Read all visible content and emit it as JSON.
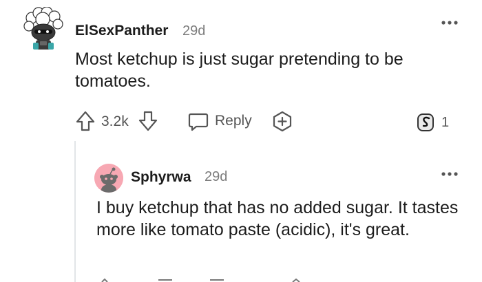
{
  "comment": {
    "author": "ElSexPanther",
    "time": "29d",
    "body": "Most ketchup is just sugar pretending to be tomatoes.",
    "votes": "3.2k",
    "reply_label": "Reply",
    "award_count": "1",
    "icons": {
      "avatar": "snoo-avatar-icon",
      "upvote": "arrow-up-icon",
      "downvote": "arrow-down-icon",
      "reply": "speech-bubble-icon",
      "award": "plus-award-icon",
      "badge": "award-badge-icon",
      "more": "more-horizontal-icon"
    }
  },
  "reply": {
    "author": "Sphyrwa",
    "time": "29d",
    "body": "I buy ketchup that has no added sugar. It tastes more like tomato paste (acidic), it's great.",
    "icons": {
      "avatar": "snoo-avatar-icon",
      "more": "more-horizontal-icon"
    }
  }
}
